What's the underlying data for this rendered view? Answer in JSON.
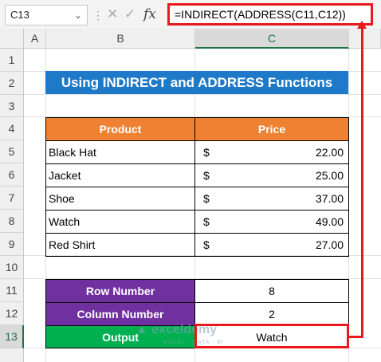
{
  "name_box": "C13",
  "formula": "=INDIRECT(ADDRESS(C11,C12))",
  "columns": [
    "A",
    "B",
    "C"
  ],
  "rows": [
    "1",
    "2",
    "3",
    "4",
    "5",
    "6",
    "7",
    "8",
    "9",
    "10",
    "11",
    "12",
    "13"
  ],
  "title": "Using INDIRECT and ADDRESS Functions",
  "table": {
    "headers": [
      "Product",
      "Price"
    ],
    "items": [
      {
        "product": "Black Hat",
        "currency": "$",
        "price": "22.00"
      },
      {
        "product": "Jacket",
        "currency": "$",
        "price": "25.00"
      },
      {
        "product": "Shoe",
        "currency": "$",
        "price": "37.00"
      },
      {
        "product": "Watch",
        "currency": "$",
        "price": "49.00"
      },
      {
        "product": "Red Shirt",
        "currency": "$",
        "price": "27.00"
      }
    ]
  },
  "lookup": {
    "row_label": "Row Number",
    "row_value": "8",
    "col_label": "Column Number",
    "col_value": "2",
    "out_label": "Output",
    "out_value": "Watch"
  },
  "watermark": {
    "brand": "exceldemy",
    "tagline": "EXCEL · DATA · BI"
  },
  "colors": {
    "title_bg": "#1f79c9",
    "header_bg": "#ef8132",
    "label_bg": "#7030a0",
    "output_bg": "#00b050",
    "highlight": "#e8191e"
  }
}
